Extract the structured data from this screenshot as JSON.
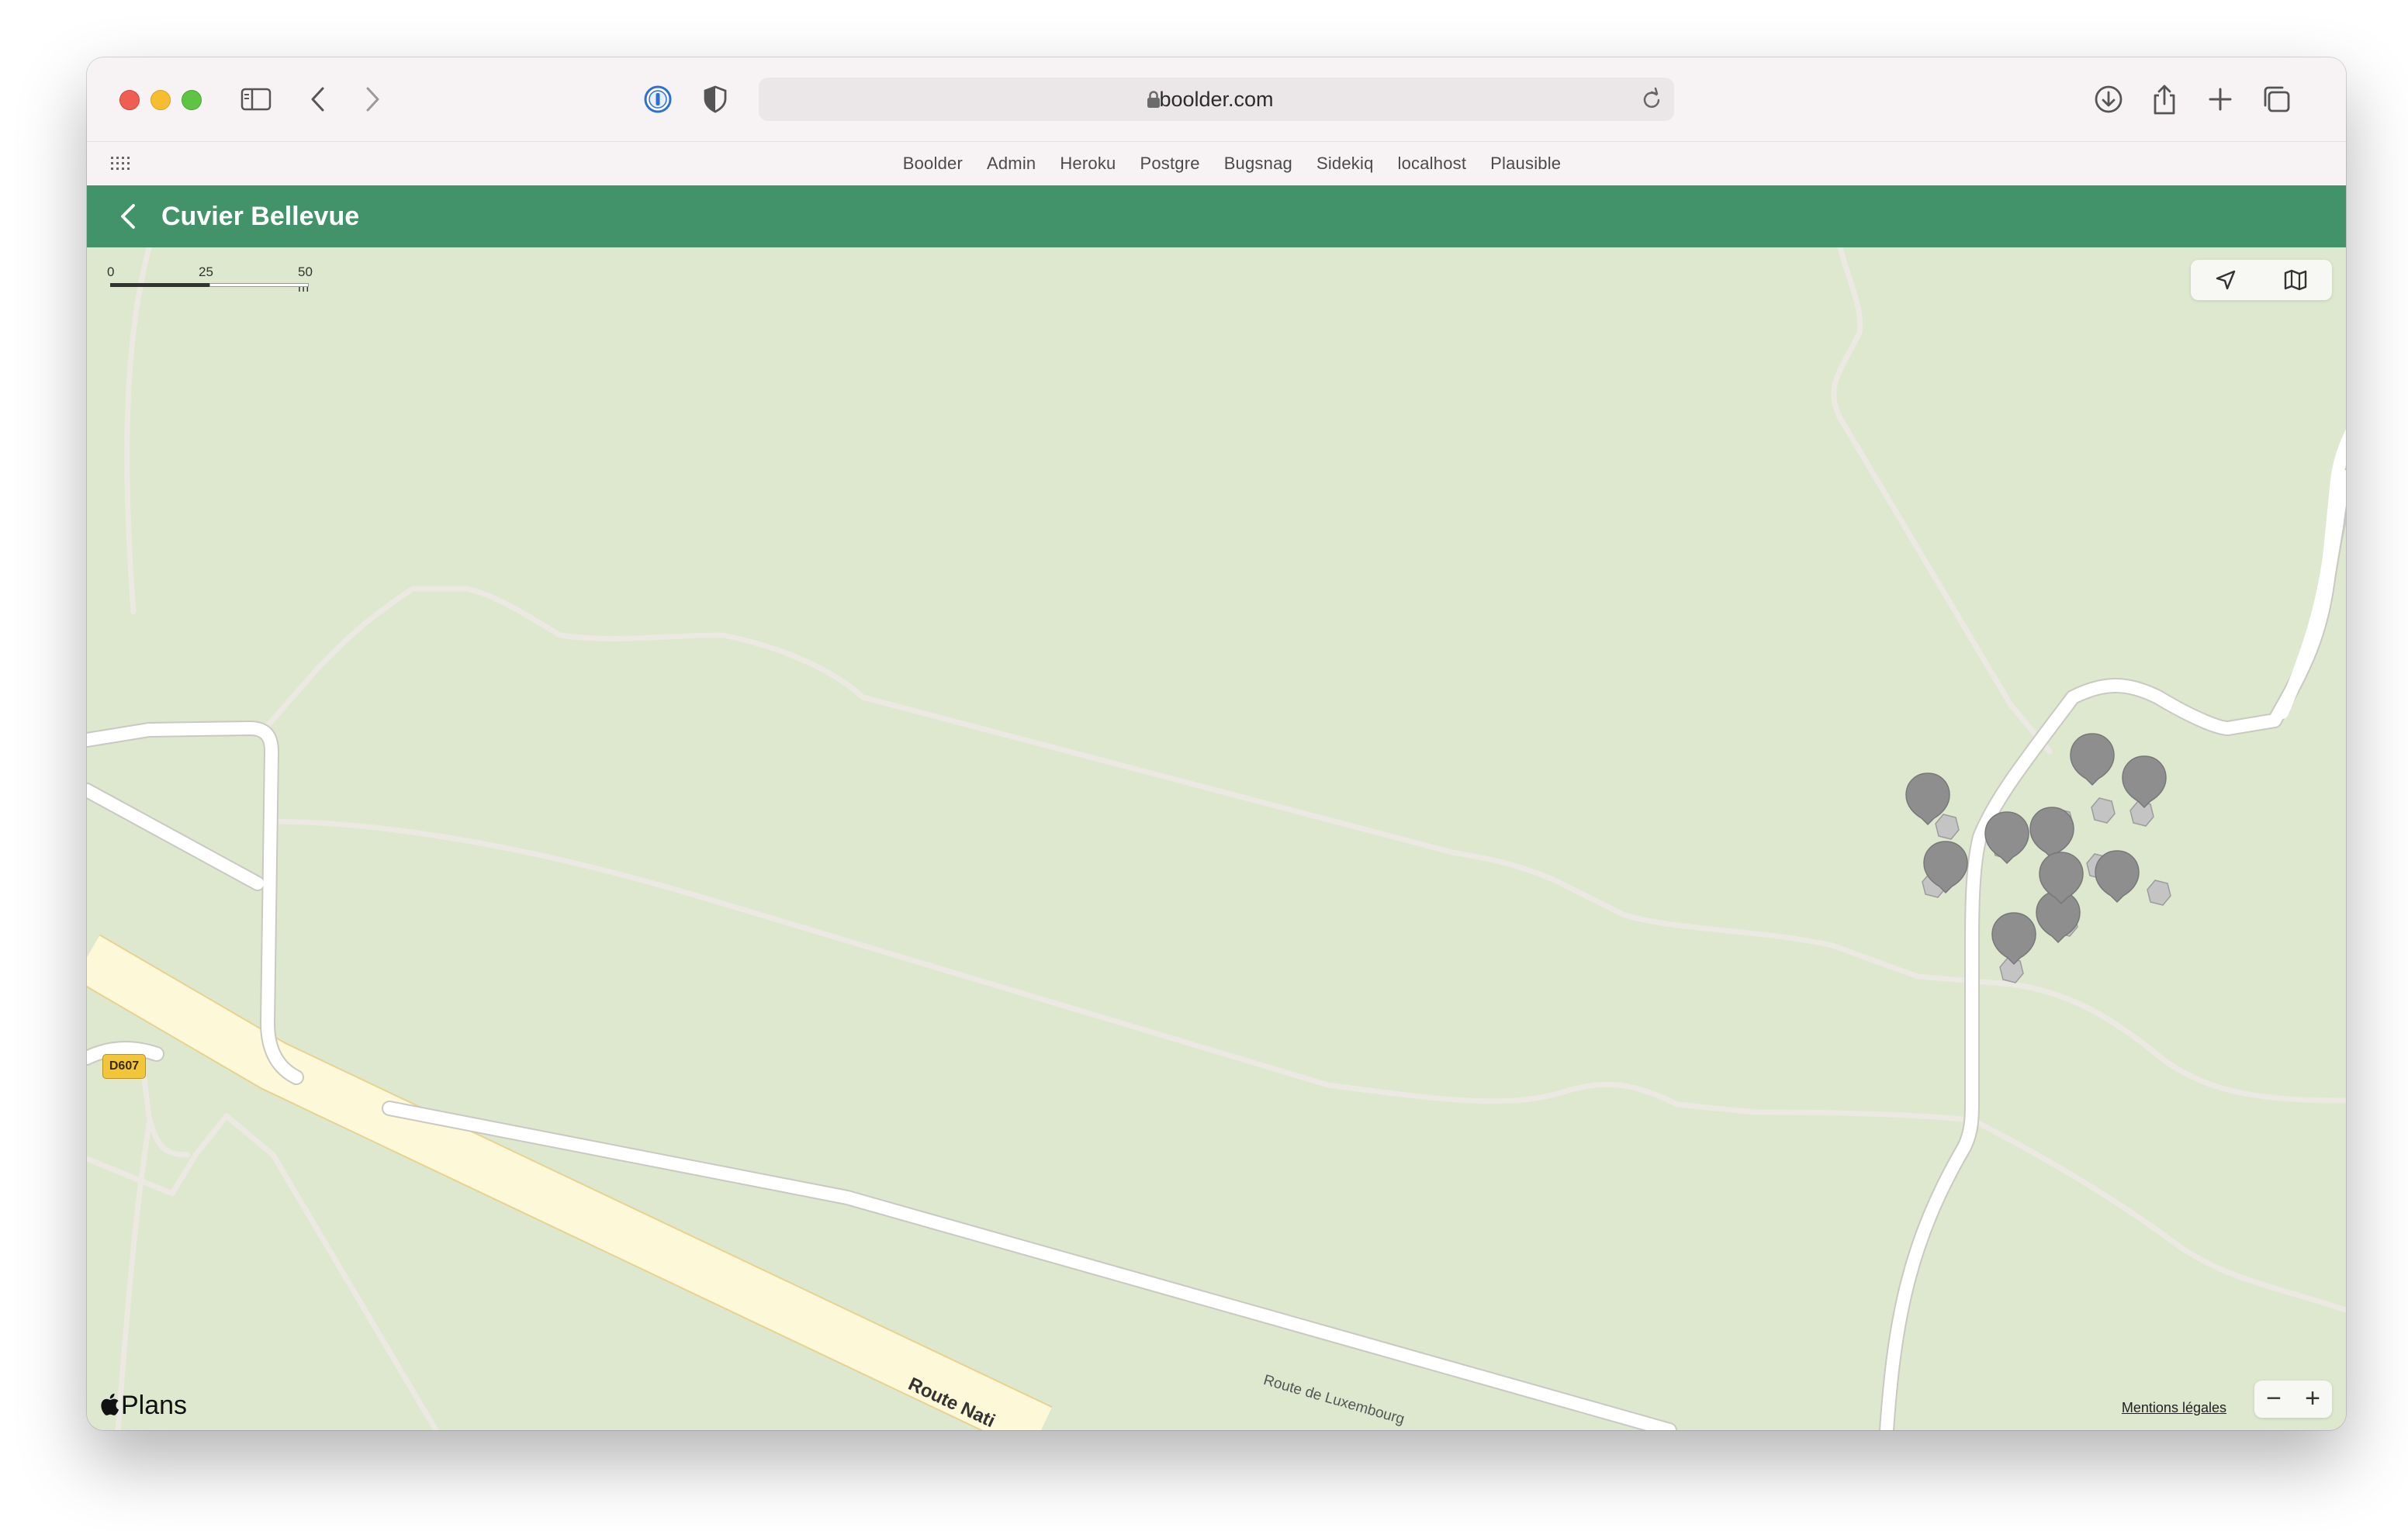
{
  "browser": {
    "url": "boolder.com",
    "favorites": [
      "Boolder",
      "Admin",
      "Heroku",
      "Postgre",
      "Bugsnag",
      "Sidekiq",
      "localhost",
      "Plausible"
    ]
  },
  "app": {
    "title": "Cuvier Bellevue"
  },
  "map": {
    "scale": {
      "zero": "0",
      "mid": "25",
      "max": "50 m"
    },
    "road_badge": "D607",
    "road_label_minor": "Route de Luxembourg",
    "road_label_major": "Route Nati",
    "attribution": "Plans",
    "legal_link": "Mentions légales",
    "zoom_out": "−",
    "zoom_in": "+",
    "boulder_marker_count": 10,
    "colors": {
      "land": "#dde8cf",
      "header": "#43936a",
      "marker": "#8e8e8e",
      "highway": "#fdf8d8"
    }
  }
}
